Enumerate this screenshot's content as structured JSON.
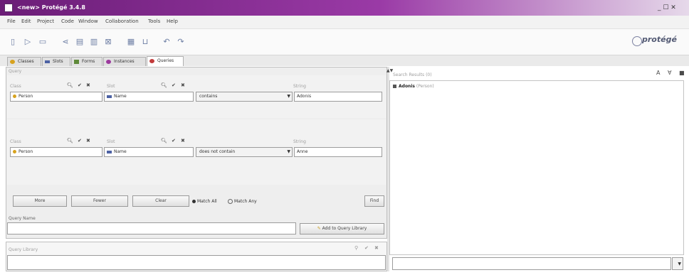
{
  "window": {
    "title": "<new> Protégé 3.4.8",
    "controls": "_ ☐ ✕"
  },
  "menu": [
    "File",
    "Edit",
    "Project",
    "Code",
    "Window",
    "Collaboration",
    "Tools",
    "Help"
  ],
  "toolbar": {
    "logo_text": "protégé"
  },
  "tabs": [
    {
      "label": "Classes",
      "icon_color": "#d7a21e"
    },
    {
      "label": "Slots",
      "icon_color": "#4d62a4"
    },
    {
      "label": "Forms",
      "icon_color": "#5f8a3a"
    },
    {
      "label": "Instances",
      "icon_color": "#9c3a9e"
    },
    {
      "label": "Queries",
      "icon_color": "#c23b3b"
    }
  ],
  "query": {
    "header": "Query",
    "rows": [
      {
        "class_label": "Class",
        "slot_label": "Slot",
        "string_label": "String",
        "class_value": "Person",
        "slot_value": "Name",
        "operator": "contains",
        "string_value": "Adonis"
      },
      {
        "class_label": "Class",
        "slot_label": "Slot",
        "string_label": "String",
        "class_value": "Person",
        "slot_value": "Name",
        "operator": "does not contain",
        "string_value": "Anne"
      }
    ],
    "more_button": "More",
    "fewer_button": "Fewer",
    "clear_button": "Clear",
    "match_all": "Match All",
    "match_any": "Match Any",
    "find_button": "Find",
    "query_name_label": "Query Name",
    "query_name_value": "",
    "add_library_button": "Add to Query Library",
    "library_label": "Query Library"
  },
  "results": {
    "header": "Search Results (0)",
    "column_header": "Adonis",
    "column_sub": "(Person)"
  }
}
